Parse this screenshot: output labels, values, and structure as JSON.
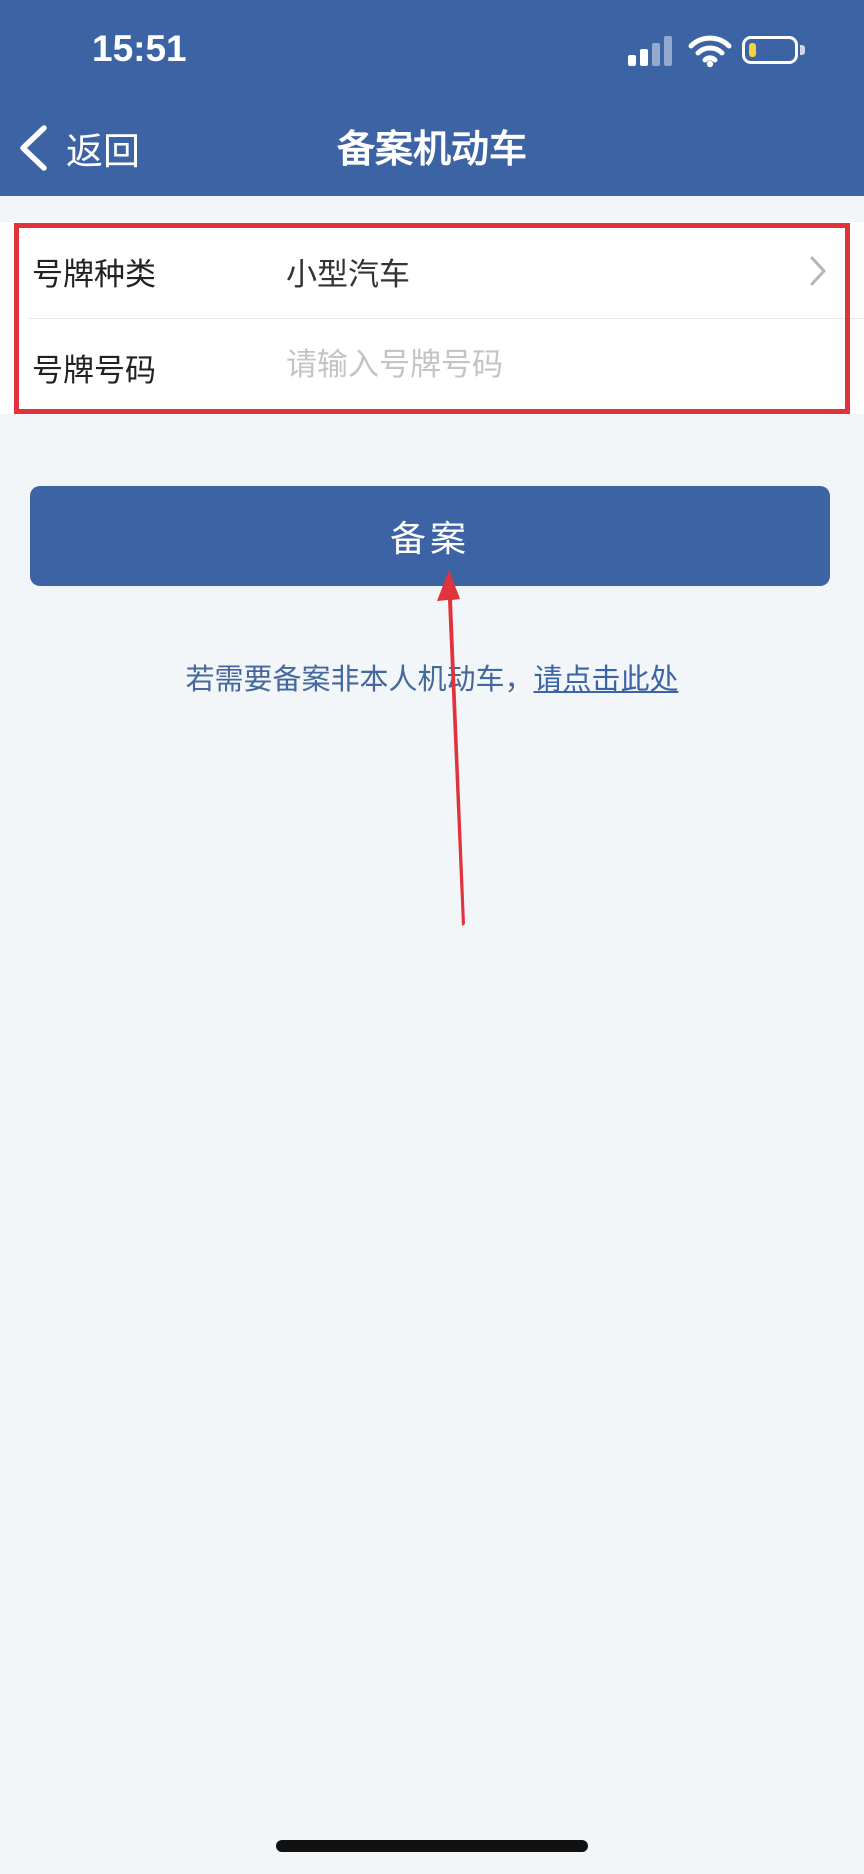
{
  "status_bar": {
    "time": "15:51",
    "signal_icon": "cellular-signal-icon",
    "wifi_icon": "wifi-icon",
    "battery_icon": "battery-icon",
    "battery_level": 0.15,
    "battery_color": "#f5d33a"
  },
  "nav": {
    "back_label": "返回",
    "back_icon": "chevron-left-icon",
    "title": "备案机动车"
  },
  "form": {
    "plate_type": {
      "label": "号牌种类",
      "value": "小型汽车",
      "icon": "chevron-right-icon"
    },
    "plate_number": {
      "label": "号牌号码",
      "value": "",
      "placeholder": "请输入号牌号码"
    }
  },
  "submit_label": "备案",
  "hint": {
    "text": "若需要备案非本人机动车，",
    "link": "请点击此处"
  },
  "colors": {
    "header": "#3c64a4",
    "annotation": "#e0333b",
    "background": "#f2f6f9"
  }
}
